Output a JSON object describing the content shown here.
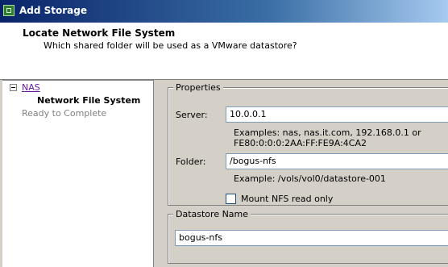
{
  "window": {
    "title": "Add Storage",
    "icon": "vmware-storage-icon"
  },
  "header": {
    "title": "Locate Network File System",
    "subtitle": "Which shared folder will be used as a VMware datastore?"
  },
  "steps": {
    "group": "NAS",
    "current": "Network File System",
    "next": "Ready to Complete"
  },
  "properties": {
    "title": "Properties",
    "server_label": "Server:",
    "server_value": "10.0.0.1",
    "server_hint": "Examples: nas, nas.it.com, 192.168.0.1 or\nFE80:0:0:0:2AA:FF:FE9A:4CA2",
    "folder_label": "Folder:",
    "folder_value": "/bogus-nfs",
    "folder_hint": "Example: /vols/vol0/datastore-001",
    "readonly_label": "Mount NFS read only",
    "readonly_checked": false
  },
  "datastore": {
    "title": "Datastore Name",
    "value": "bogus-nfs"
  }
}
